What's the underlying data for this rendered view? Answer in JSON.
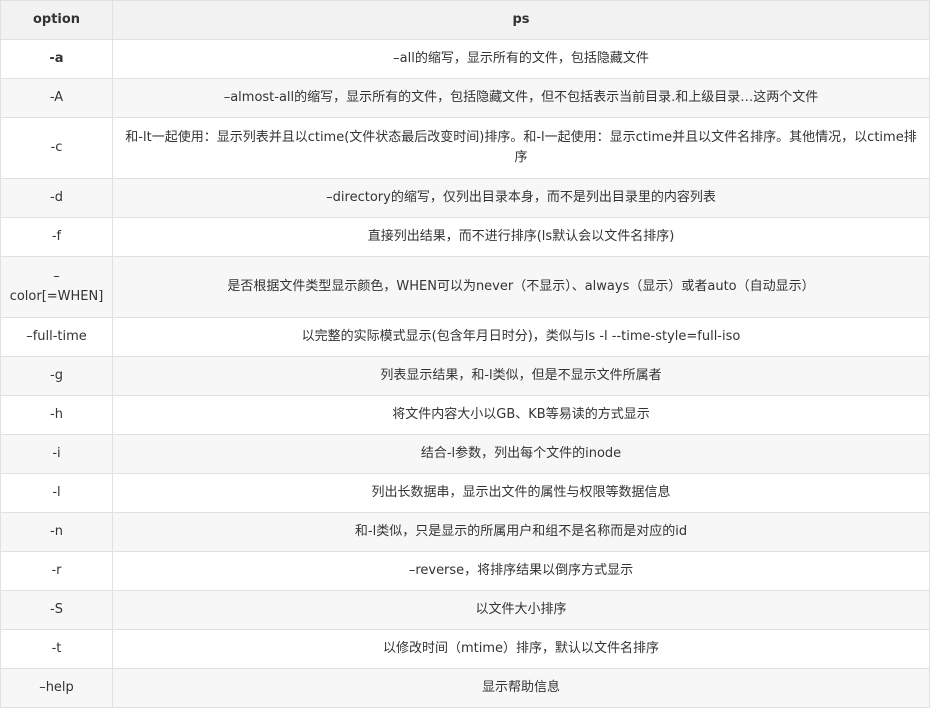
{
  "table": {
    "headers": [
      "option",
      "ps"
    ],
    "rows": [
      {
        "option": "-a",
        "ps": "–all的缩写，显示所有的文件，包括隐藏文件"
      },
      {
        "option": "-A",
        "ps": "–almost-all的缩写，显示所有的文件，包括隐藏文件，但不包括表示当前目录.和上级目录…这两个文件"
      },
      {
        "option": "-c",
        "ps": "和-lt一起使用：显示列表并且以ctime(文件状态最后改变时间)排序。和-l一起使用：显示ctime并且以文件名排序。其他情况，以ctime排序"
      },
      {
        "option": "-d",
        "ps": "–directory的缩写，仅列出目录本身，而不是列出目录里的内容列表"
      },
      {
        "option": "-f",
        "ps": "直接列出结果，而不进行排序(ls默认会以文件名排序)"
      },
      {
        "option": "–color[=WHEN]",
        "ps": "是否根据文件类型显示颜色，WHEN可以为never（不显示）、always（显示）或者auto（自动显示）"
      },
      {
        "option": "–full-time",
        "ps": "以完整的实际模式显示(包含年月日时分)，类似与ls -l --time-style=full-iso"
      },
      {
        "option": "-g",
        "ps": "列表显示结果，和-l类似，但是不显示文件所属者"
      },
      {
        "option": "-h",
        "ps": "将文件内容大小以GB、KB等易读的方式显示"
      },
      {
        "option": "-i",
        "ps": "结合-l参数，列出每个文件的inode"
      },
      {
        "option": "-l",
        "ps": "列出长数据串，显示出文件的属性与权限等数据信息"
      },
      {
        "option": "-n",
        "ps": "和-l类似，只是显示的所属用户和组不是名称而是对应的id"
      },
      {
        "option": "-r",
        "ps": "–reverse，将排序结果以倒序方式显示"
      },
      {
        "option": "-S",
        "ps": "以文件大小排序"
      },
      {
        "option": "-t",
        "ps": "以修改时间（mtime）排序，默认以文件名排序"
      },
      {
        "option": "–help",
        "ps": "显示帮助信息"
      }
    ]
  }
}
